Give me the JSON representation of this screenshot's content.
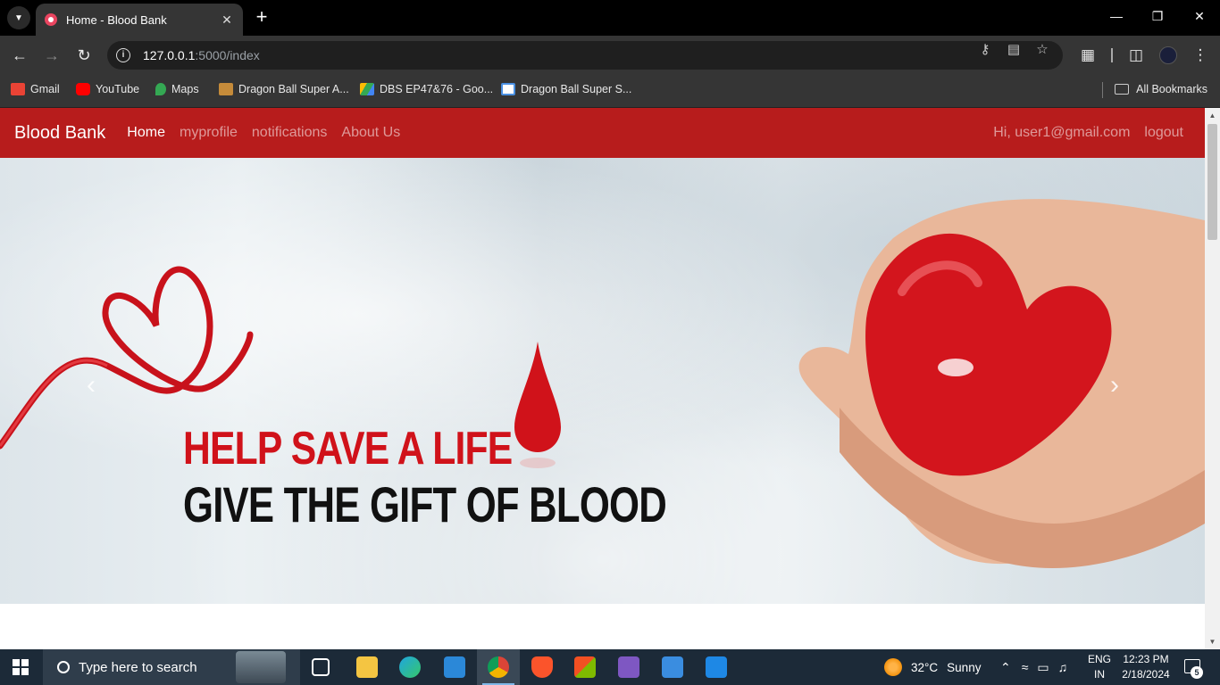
{
  "browser": {
    "tab_title": "Home - Blood Bank",
    "url_host": "127.0.0.1",
    "url_rest": ":5000/index",
    "bookmarks": [
      {
        "label": "Gmail",
        "icon": "gmail-icon",
        "color": "#ea4335"
      },
      {
        "label": "YouTube",
        "icon": "youtube-icon",
        "color": "#ff0000"
      },
      {
        "label": "Maps",
        "icon": "maps-icon",
        "color": "#34a853"
      },
      {
        "label": "Dragon Ball Super A...",
        "icon": "image-icon",
        "color": "#c58b3a"
      },
      {
        "label": "DBS EP47&76 - Goo...",
        "icon": "google-drive-icon",
        "color": "#fbbc04"
      },
      {
        "label": "Dragon Ball Super S...",
        "icon": "site-icon",
        "color": "#4a90e2"
      }
    ],
    "all_bookmarks": "All Bookmarks"
  },
  "site": {
    "brand": "Blood Bank",
    "nav": {
      "home": "Home",
      "myprofile": "myprofile",
      "notifications": "notifications",
      "about": "About Us"
    },
    "greeting": "Hi, user1@gmail.com",
    "logout": "logout"
  },
  "hero": {
    "line1": "HELP SAVE A LIFE",
    "line2": "GIVE THE GIFT OF BLOOD"
  },
  "taskbar": {
    "search_placeholder": "Type here to search",
    "weather_temp": "32°C",
    "weather_desc": "Sunny",
    "lang1": "ENG",
    "lang2": "IN",
    "time": "12:23 PM",
    "date": "2/18/2024",
    "notification_count": "5"
  }
}
